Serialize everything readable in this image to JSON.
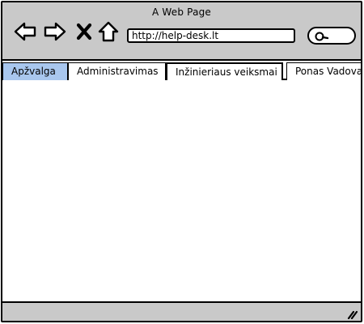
{
  "window": {
    "title": "A Web Page"
  },
  "toolbar": {
    "back_icon": "back-arrow-icon",
    "forward_icon": "forward-arrow-icon",
    "stop_icon": "close-x-icon",
    "home_icon": "home-icon",
    "search_icon": "search-icon"
  },
  "address_bar": {
    "value": "http://help-desk.lt"
  },
  "tabs": [
    {
      "label": "Apžvalga",
      "active": true
    },
    {
      "label": "Administravimas",
      "active": false
    },
    {
      "label": "Inžinieriaus veiksmai",
      "active": false
    },
    {
      "label": "Ponas Vadovas",
      "active": false
    }
  ],
  "colors": {
    "chrome": "#c9c9c9",
    "active_tab": "#a9c7ee",
    "border": "#000000"
  }
}
